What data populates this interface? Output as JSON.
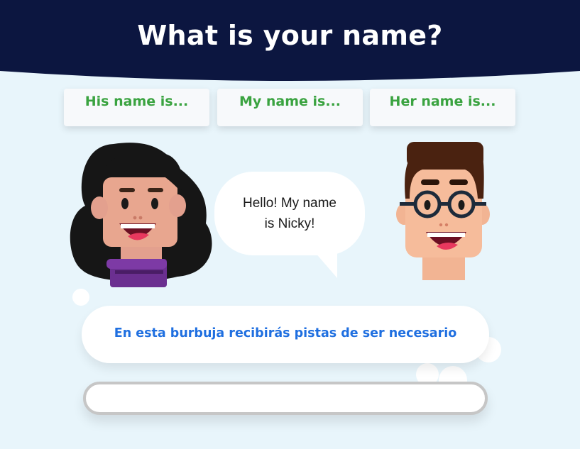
{
  "header": {
    "title": "What is your name?",
    "background": "#0c1640"
  },
  "options": [
    {
      "label": "His name is..."
    },
    {
      "label": "My name is..."
    },
    {
      "label": "Her name is..."
    }
  ],
  "speech": {
    "line1": "Hello! My name",
    "line2": "is Nicky!"
  },
  "hint": {
    "text": "En esta burbuja recibirás pistas de ser necesario",
    "color": "#1f6fe0"
  },
  "answer_input": {
    "value": "",
    "placeholder": ""
  },
  "colors": {
    "page_background": "#e8f5fb",
    "option_text": "#3aa340"
  },
  "characters": [
    {
      "icon": "girl-avatar-icon"
    },
    {
      "icon": "boy-avatar-icon"
    }
  ]
}
